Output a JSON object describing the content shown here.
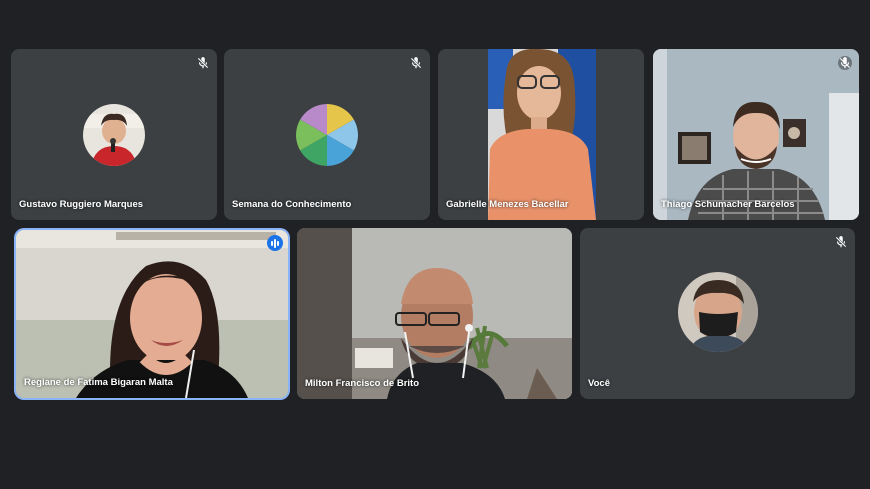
{
  "participants": [
    {
      "name": "Gustavo Ruggiero Marques",
      "muted": true,
      "speaking": false
    },
    {
      "name": "Semana do Conhecimento",
      "muted": true,
      "speaking": false
    },
    {
      "name": "Gabrielle Menezes Bacellar",
      "muted": false,
      "speaking": false
    },
    {
      "name": "Thiago Schumacher Barcelos",
      "muted": true,
      "speaking": false
    },
    {
      "name": "Regiane de Fatima Bigaran Malta",
      "muted": false,
      "speaking": true
    },
    {
      "name": "Milton Francisco de Brito",
      "muted": false,
      "speaking": false
    },
    {
      "name": "Você",
      "muted": true,
      "speaking": false
    }
  ],
  "colors": {
    "background": "#202124",
    "tile": "#3c4043",
    "speaking_outline": "#8ab4f8",
    "speaking_badge": "#1a73e8"
  },
  "icons": {
    "muted": "mic-off-icon",
    "speaking": "audio-level-icon"
  }
}
